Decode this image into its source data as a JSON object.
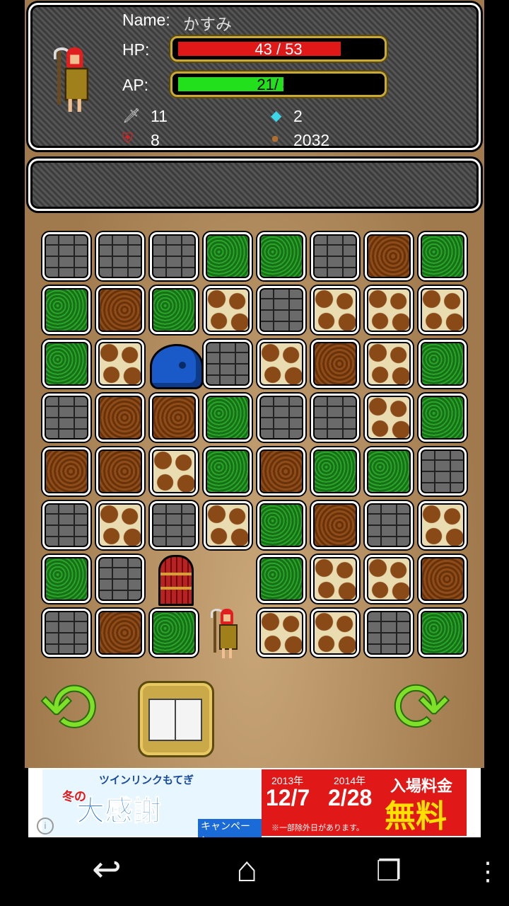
{
  "player": {
    "name_label": "Name:",
    "name": "かすみ",
    "hp_label": "HP:",
    "hp_text": "43 / 53",
    "hp_current": 43,
    "hp_max": 53,
    "ap_label": "AP:",
    "ap_text": "21/ 40",
    "ap_current": 21,
    "ap_max": 40,
    "attack": "11",
    "defense": "8",
    "gems": "2",
    "gold": "2032",
    "hp_color": "#e01818",
    "ap_color": "#22e01c"
  },
  "message": "",
  "board": {
    "rows": [
      [
        "stone",
        "stone",
        "stone",
        "grass",
        "grass",
        "stone",
        "dirt",
        "grass"
      ],
      [
        "grass",
        "dirt",
        "grass",
        "giraffe",
        "stone",
        "giraffe",
        "giraffe",
        "giraffe"
      ],
      [
        "grass",
        "giraffe",
        "slime",
        "stone",
        "giraffe",
        "dirt",
        "giraffe",
        "grass"
      ],
      [
        "stone",
        "dirt",
        "dirt",
        "grass",
        "stone",
        "stone",
        "giraffe",
        "grass"
      ],
      [
        "dirt",
        "dirt",
        "giraffe",
        "grass",
        "dirt",
        "grass",
        "grass",
        "stone"
      ],
      [
        "stone",
        "giraffe",
        "stone",
        "giraffe",
        "grass",
        "dirt",
        "stone",
        "giraffe"
      ],
      [
        "grass",
        "stone",
        "door",
        "empty",
        "grass",
        "giraffe",
        "giraffe",
        "dirt"
      ],
      [
        "stone",
        "dirt",
        "grass",
        "hero",
        "giraffe",
        "giraffe",
        "stone",
        "grass"
      ]
    ]
  },
  "controls": {
    "rotate_left_icon": "rotate-left-icon",
    "rotate_right_icon": "rotate-right-icon",
    "book_icon": "book-icon"
  },
  "ad": {
    "top_text": "ツインリンクもてぎ",
    "season": "冬の",
    "headline": "大感謝",
    "campaign": "キャンペーン",
    "year1": "2013年",
    "date1": "12/7",
    "year2": "2014年",
    "date2": "2/28",
    "admission": "入場料金",
    "free": "無料",
    "note": "※一部除外日があります。"
  },
  "navbar": {
    "back_icon": "back-icon",
    "home_icon": "home-icon",
    "recents_icon": "recents-icon",
    "menu_icon": "menu-icon"
  }
}
